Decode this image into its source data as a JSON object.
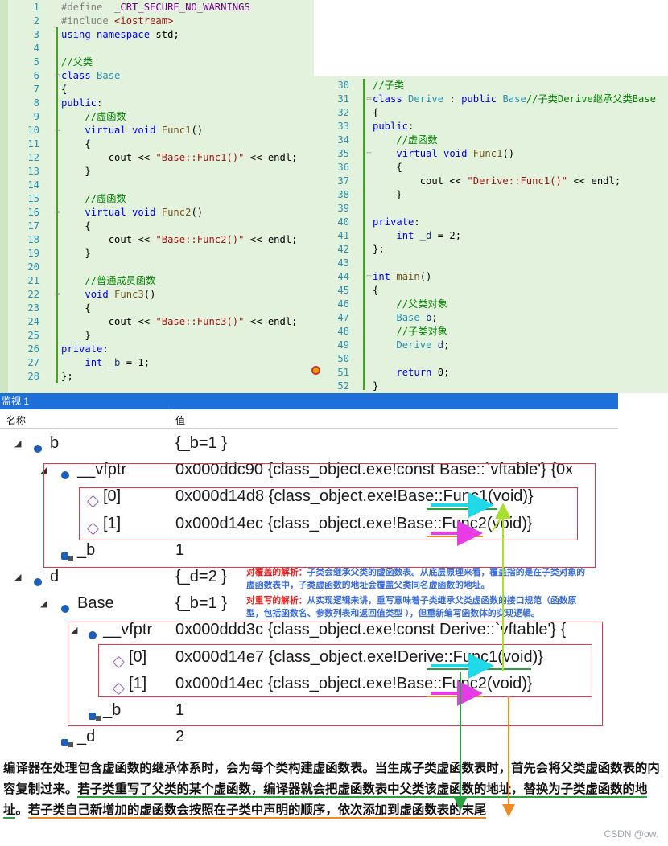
{
  "left_code": {
    "lines": [
      {
        "n": "1",
        "parts": [
          [
            "pp",
            "#define  "
          ],
          [
            "mac",
            "_CRT_SECURE_NO_WARNINGS"
          ]
        ]
      },
      {
        "n": "2",
        "parts": [
          [
            "pp",
            "#include "
          ],
          [
            "str",
            "<iostream>"
          ]
        ]
      },
      {
        "n": "3",
        "parts": [
          [
            "kw",
            "using namespace "
          ],
          [
            "plain",
            "std;"
          ]
        ]
      },
      {
        "n": "4",
        "parts": []
      },
      {
        "n": "5",
        "parts": [
          [
            "cm",
            "//父类"
          ]
        ]
      },
      {
        "n": "6",
        "parts": [
          [
            "kw",
            "class "
          ],
          [
            "ty",
            "Base"
          ]
        ]
      },
      {
        "n": "7",
        "parts": [
          [
            "plain",
            "{"
          ]
        ]
      },
      {
        "n": "8",
        "parts": [
          [
            "kw",
            "public"
          ],
          [
            "plain",
            ":"
          ]
        ]
      },
      {
        "n": "9",
        "parts": [
          [
            "plain",
            "    "
          ],
          [
            "cm",
            "//虚函数"
          ]
        ]
      },
      {
        "n": "10",
        "parts": [
          [
            "plain",
            "    "
          ],
          [
            "kw",
            "virtual void "
          ],
          [
            "fn",
            "Func1"
          ],
          [
            "plain",
            "()"
          ]
        ]
      },
      {
        "n": "11",
        "parts": [
          [
            "plain",
            "    {"
          ]
        ]
      },
      {
        "n": "12",
        "parts": [
          [
            "plain",
            "        cout << "
          ],
          [
            "str",
            "\"Base::Func1()\""
          ],
          [
            "plain",
            " << endl;"
          ]
        ]
      },
      {
        "n": "13",
        "parts": [
          [
            "plain",
            "    }"
          ]
        ]
      },
      {
        "n": "14",
        "parts": []
      },
      {
        "n": "15",
        "parts": [
          [
            "plain",
            "    "
          ],
          [
            "cm",
            "//虚函数"
          ]
        ]
      },
      {
        "n": "16",
        "parts": [
          [
            "plain",
            "    "
          ],
          [
            "kw",
            "virtual void "
          ],
          [
            "fn",
            "Func2"
          ],
          [
            "plain",
            "()"
          ]
        ]
      },
      {
        "n": "17",
        "parts": [
          [
            "plain",
            "    {"
          ]
        ]
      },
      {
        "n": "18",
        "parts": [
          [
            "plain",
            "        cout << "
          ],
          [
            "str",
            "\"Base::Func2()\""
          ],
          [
            "plain",
            " << endl;"
          ]
        ]
      },
      {
        "n": "19",
        "parts": [
          [
            "plain",
            "    }"
          ]
        ]
      },
      {
        "n": "20",
        "parts": []
      },
      {
        "n": "21",
        "parts": [
          [
            "plain",
            "    "
          ],
          [
            "cm",
            "//普通成员函数"
          ]
        ]
      },
      {
        "n": "22",
        "parts": [
          [
            "plain",
            "    "
          ],
          [
            "kw",
            "void "
          ],
          [
            "fn",
            "Func3"
          ],
          [
            "plain",
            "()"
          ]
        ]
      },
      {
        "n": "23",
        "parts": [
          [
            "plain",
            "    {"
          ]
        ]
      },
      {
        "n": "24",
        "parts": [
          [
            "plain",
            "        cout << "
          ],
          [
            "str",
            "\"Base::Func3()\""
          ],
          [
            "plain",
            " << endl;"
          ]
        ]
      },
      {
        "n": "25",
        "parts": [
          [
            "plain",
            "    }"
          ]
        ]
      },
      {
        "n": "26",
        "parts": [
          [
            "kw",
            "private"
          ],
          [
            "plain",
            ":"
          ]
        ]
      },
      {
        "n": "27",
        "parts": [
          [
            "plain",
            "    "
          ],
          [
            "kw",
            "int "
          ],
          [
            "var",
            "_b"
          ],
          [
            "plain",
            " = 1;"
          ]
        ]
      },
      {
        "n": "28",
        "parts": [
          [
            "plain",
            "};"
          ]
        ]
      }
    ]
  },
  "right_code": {
    "lines": [
      {
        "n": "30",
        "parts": [
          [
            "cm",
            "//子类"
          ]
        ]
      },
      {
        "n": "31",
        "parts": [
          [
            "kw",
            "class "
          ],
          [
            "ty",
            "Derive"
          ],
          [
            "plain",
            " : "
          ],
          [
            "kw",
            "public "
          ],
          [
            "ty",
            "Base"
          ],
          [
            "cm",
            "//子类Derive继承父类Base"
          ]
        ]
      },
      {
        "n": "32",
        "parts": [
          [
            "plain",
            "{"
          ]
        ]
      },
      {
        "n": "33",
        "parts": [
          [
            "kw",
            "public"
          ],
          [
            "plain",
            ":"
          ]
        ]
      },
      {
        "n": "34",
        "parts": [
          [
            "plain",
            "    "
          ],
          [
            "cm",
            "//虚函数"
          ]
        ]
      },
      {
        "n": "35",
        "parts": [
          [
            "plain",
            "    "
          ],
          [
            "kw",
            "virtual void "
          ],
          [
            "fn",
            "Func1"
          ],
          [
            "plain",
            "()"
          ]
        ]
      },
      {
        "n": "36",
        "parts": [
          [
            "plain",
            "    {"
          ]
        ]
      },
      {
        "n": "37",
        "parts": [
          [
            "plain",
            "        cout << "
          ],
          [
            "str",
            "\"Derive::Func1()\""
          ],
          [
            "plain",
            " << endl;"
          ]
        ]
      },
      {
        "n": "38",
        "parts": [
          [
            "plain",
            "    }"
          ]
        ]
      },
      {
        "n": "39",
        "parts": []
      },
      {
        "n": "40",
        "parts": [
          [
            "kw",
            "private"
          ],
          [
            "plain",
            ":"
          ]
        ]
      },
      {
        "n": "41",
        "parts": [
          [
            "plain",
            "    "
          ],
          [
            "kw",
            "int "
          ],
          [
            "var",
            "_d"
          ],
          [
            "plain",
            " = 2;"
          ]
        ]
      },
      {
        "n": "42",
        "parts": [
          [
            "plain",
            "};"
          ]
        ]
      },
      {
        "n": "43",
        "parts": []
      },
      {
        "n": "44",
        "parts": [
          [
            "kw",
            "int "
          ],
          [
            "fn",
            "main"
          ],
          [
            "plain",
            "()"
          ]
        ]
      },
      {
        "n": "45",
        "parts": [
          [
            "plain",
            "{"
          ]
        ]
      },
      {
        "n": "46",
        "parts": [
          [
            "plain",
            "    "
          ],
          [
            "cm",
            "//父类对象"
          ]
        ]
      },
      {
        "n": "47",
        "parts": [
          [
            "plain",
            "    "
          ],
          [
            "ty",
            "Base "
          ],
          [
            "var",
            "b"
          ],
          [
            "plain",
            ";"
          ]
        ]
      },
      {
        "n": "48",
        "parts": [
          [
            "plain",
            "    "
          ],
          [
            "cm",
            "//子类对象"
          ]
        ]
      },
      {
        "n": "49",
        "parts": [
          [
            "plain",
            "    "
          ],
          [
            "ty",
            "Derive "
          ],
          [
            "var",
            "d"
          ],
          [
            "plain",
            ";"
          ]
        ]
      },
      {
        "n": "50",
        "parts": []
      },
      {
        "n": "51",
        "parts": [
          [
            "plain",
            "    "
          ],
          [
            "kw",
            "return "
          ],
          [
            "plain",
            "0;"
          ]
        ]
      },
      {
        "n": "52",
        "parts": [
          [
            "plain",
            "}"
          ]
        ]
      }
    ]
  },
  "watch": {
    "title": "监视 1",
    "col_name": "名称",
    "col_value": "值",
    "rows": [
      {
        "name": "b",
        "value": "{_b=1 }"
      },
      {
        "name": "__vfptr",
        "value": "0x000ddc90 {class_object.exe!const Base::`vftable'} {0x"
      },
      {
        "name": "[0]",
        "value": "0x000d14d8 {class_object.exe!Base::Func1(void)}"
      },
      {
        "name": "[1]",
        "value": "0x000d14ec {class_object.exe!Base::Func2(void)}"
      },
      {
        "name": "_b",
        "value": "1"
      },
      {
        "name": "d",
        "value": "{_d=2 }"
      },
      {
        "name": "Base",
        "value": "{_b=1 }"
      },
      {
        "name": "__vfptr",
        "value": "0x000ddd3c {class_object.exe!const Derive::`vftable'} {"
      },
      {
        "name": "[0]",
        "value": "0x000d14e7 {class_object.exe!Derive::Func1(void)}"
      },
      {
        "name": "[1]",
        "value": "0x000d14ec {class_object.exe!Base::Func2(void)}"
      },
      {
        "name": "_b",
        "value": "1"
      },
      {
        "name": "_d",
        "value": "2"
      }
    ]
  },
  "annotations": {
    "override_title": "对覆盖的解析：",
    "override_line1": "子类会继承父类的虚函数表。从底层原理来看，覆盖指的是在子类对象的",
    "override_line2": "虚函数表中，子类虚函数的地址会覆盖父类同名虚函数的地址。",
    "rewrite_title": "对重写的解析：",
    "rewrite_line1": "从实现逻辑来讲，重写意味着子类继承父类虚函数的接口规范（函数原",
    "rewrite_line2": "型，包括函数名、参数列表和返回值类型 ），但重新编写函数体的实现逻辑。"
  },
  "explanation": {
    "part1": "编译器在处理包含虚函数的继承体系时，会为每个类构建虚函数表。当生成子类虚函数表时，首先会将父类虚函数表的内容复制过来。",
    "part2": "若子类重写了父类的某个虚函数，编译器就会把虚函数表中父类该虚函数的地址，替换为子类虚函数的地址",
    "part3": "。",
    "part4": "若子类自己新增加的虚函数会按照在子类中声明的顺序，依次添加到虚函数表的末尾"
  },
  "watermark": "CSDN @ow.",
  "colors": {
    "editor_bg": "#e3f2dc",
    "keyword": "#0000ff",
    "type": "#2b91af",
    "comment": "#008000",
    "string": "#a31515",
    "watch_title_bg": "#1e6fd9",
    "box_red": "#e2394a",
    "arrow_green": "#2aa040",
    "arrow_orange": "#f08a24",
    "arrow_cyan": "#20d8e8",
    "arrow_magenta": "#e63be6",
    "arrow_lime": "#a8e030"
  }
}
